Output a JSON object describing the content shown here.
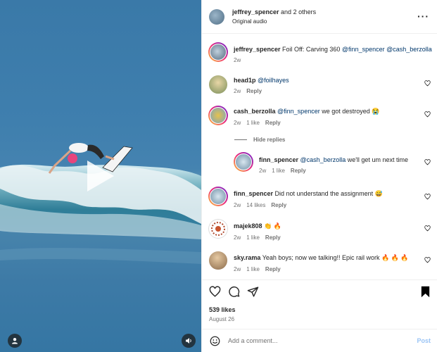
{
  "header": {
    "username": "jeffrey_spencer",
    "others": " and 2 others",
    "subtitle": "Original audio",
    "more_icon": "more-horizontal-icon"
  },
  "caption": {
    "username": "jeffrey_spencer",
    "text": " Foil Off: Carving 360 ",
    "mention1": "@finn_spencer",
    "mention2": " @cash_berzolla",
    "age": "2w"
  },
  "comments": [
    {
      "username": "head1p",
      "mention": " @foilhayes",
      "text": "",
      "age": "2w",
      "likes": "",
      "reply": "Reply"
    },
    {
      "username": "cash_berzolla",
      "mention": " @finn_spencer",
      "text": " we got destroyed 😭",
      "age": "2w",
      "likes": "1 like",
      "reply": "Reply"
    },
    {
      "username": "finn_spencer",
      "mention": " @cash_berzolla",
      "text": " we'll get um next time",
      "age": "2w",
      "likes": "1 like",
      "reply": "Reply"
    },
    {
      "username": "finn_spencer",
      "mention": "",
      "text": " Did not understand the assignment 😅",
      "age": "2w",
      "likes": "14 likes",
      "reply": "Reply"
    },
    {
      "username": "majek808",
      "mention": "",
      "text": " 👏 🔥",
      "age": "2w",
      "likes": "1 like",
      "reply": "Reply"
    },
    {
      "username": "sky.rama",
      "mention": "",
      "text": " Yeah boys; now we talking!! Epic rail work 🔥 🔥 🔥",
      "age": "2w",
      "likes": "1 like",
      "reply": "Reply"
    }
  ],
  "hide_replies": "Hide replies",
  "post_info": {
    "likes": "539 likes",
    "date": "August 26"
  },
  "add_comment": {
    "placeholder": "Add a comment...",
    "post_label": "Post"
  },
  "colors": {
    "mention": "#00376b",
    "post_disabled": "#9ac4f5",
    "muted": "#737373"
  }
}
